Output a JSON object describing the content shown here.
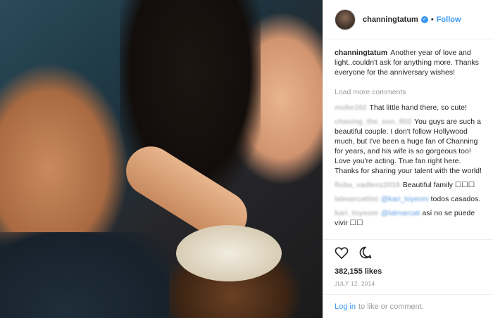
{
  "header": {
    "username": "channingtatum",
    "separator": "•",
    "follow_label": "Follow",
    "verified_glyph": "✓"
  },
  "caption": {
    "username": "channingtatum",
    "text": "Another year of love and light..couldn't ask for anything more. Thanks everyone for the anniversary wishes!"
  },
  "load_more": "Load more comments",
  "comments": [
    {
      "username": "mobe162",
      "text": "That little hand there, so cute!"
    },
    {
      "username": "chasing_the_sun_802",
      "text": "You guys are such a beautiful couple. I don't follow Hollywood much, but I've been a huge fan of Channing for years, and his wife is so gorgeous too! Love you're acting. True fan right here. Thanks for sharing your talent with the world!"
    },
    {
      "username": "fluba_vadlenz2018",
      "text": "Beautiful family ☐☐☐"
    },
    {
      "username": "lalmarcattini",
      "mention": "@kari_toyeom",
      "text": "todos casados."
    },
    {
      "username": "kari_toyeom",
      "mention": "@lalmarcati",
      "text": "así no se puede vivir ☐☐"
    }
  ],
  "actions": {
    "like_icon": "heart-icon",
    "comment_icon": "comment-icon"
  },
  "likes": "382,155 likes",
  "date": "JULY 12, 2014",
  "login": {
    "link": "Log in",
    "text": "to like or comment."
  }
}
